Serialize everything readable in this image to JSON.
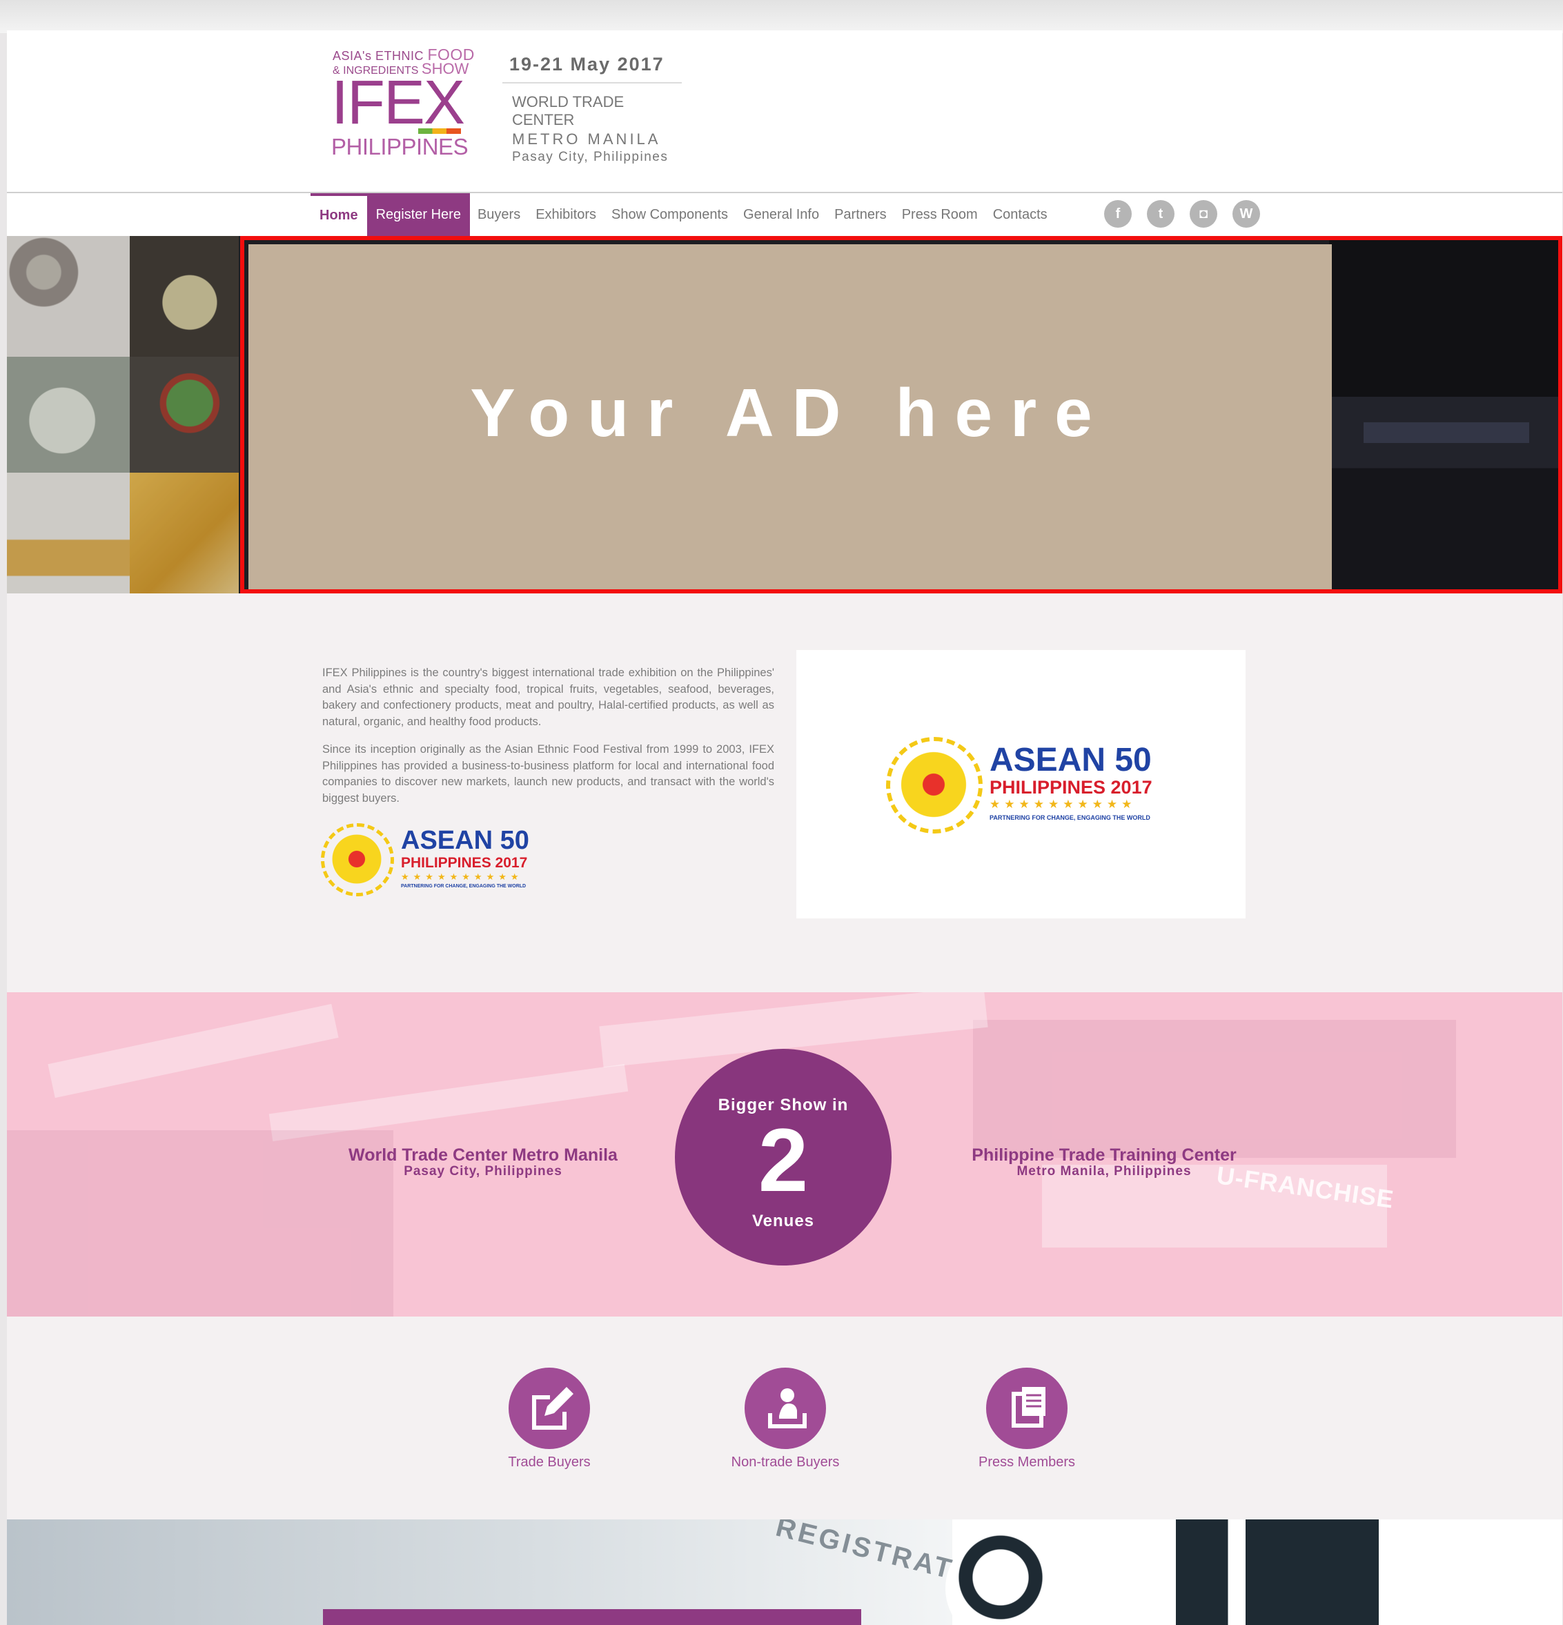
{
  "header": {
    "logo": {
      "line1_a": "ASIA's ETHNIC ",
      "line1_b": "FOOD",
      "line2_a": "& INGREDIENTS ",
      "line2_b": "SHOW",
      "brand": "IFEX",
      "country": "PHILIPPINES"
    },
    "date": "19-21 May 2017",
    "venue_line1": "WORLD TRADE CENTER",
    "venue_line2": "METRO MANILA",
    "venue_line3": "Pasay City, Philippines"
  },
  "nav": {
    "items": [
      {
        "label": "Home"
      },
      {
        "label": "Register Here"
      },
      {
        "label": "Buyers"
      },
      {
        "label": "Exhibitors"
      },
      {
        "label": "Show Components"
      },
      {
        "label": "General Info"
      },
      {
        "label": "Partners"
      },
      {
        "label": "Press Room"
      },
      {
        "label": "Contacts"
      }
    ],
    "social": [
      {
        "icon": "facebook-icon",
        "glyph": "f"
      },
      {
        "icon": "twitter-icon",
        "glyph": "t"
      },
      {
        "icon": "instagram-icon",
        "glyph": "◘"
      },
      {
        "icon": "wordpress-icon",
        "glyph": "W"
      }
    ]
  },
  "hero": {
    "ad_text": "Your AD here"
  },
  "about": {
    "paragraph1": "IFEX Philippines is the country's biggest international trade exhibition on the Philippines' and Asia's ethnic and specialty food, tropical fruits, vegetables, seafood, beverages, bakery and confectionery products, meat and poultry, Halal-certified products, as well as natural, organic, and healthy food products.",
    "paragraph2": "Since its inception originally as the Asian Ethnic Food Festival from 1999 to 2003, IFEX Philippines has provided a business-to-business platform for local and international food companies to discover new markets, launch new products, and transact with the world's biggest buyers."
  },
  "asean_logo": {
    "title": "ASEAN 50",
    "subtitle": "PHILIPPINES 2017",
    "stars": "★★★★★★★★★★",
    "tagline": "PARTNERING FOR CHANGE, ENGAGING THE WORLD"
  },
  "venues": {
    "left_name": "World Trade Center Metro Manila",
    "left_location": "Pasay City, Philippines",
    "right_name": "Philippine Trade Training Center",
    "right_location": "Metro Manila, Philippines",
    "circle_top": "Bigger Show in",
    "circle_number": "2",
    "circle_bottom": "Venues",
    "background_text": "U-FRANCHISE"
  },
  "registration": {
    "items": [
      {
        "label": "Trade Buyers",
        "icon": "edit-icon"
      },
      {
        "label": "Non-trade Buyers",
        "icon": "user-upload-icon"
      },
      {
        "label": "Press Members",
        "icon": "clipboard-icon"
      }
    ]
  },
  "bottom": {
    "sign_text": "REGISTRATION"
  },
  "colors": {
    "brand_purple": "#8e3a82",
    "ad_background": "#c2b09a",
    "ad_border": "#f30e0e",
    "band_pink": "#f8c4d4"
  }
}
